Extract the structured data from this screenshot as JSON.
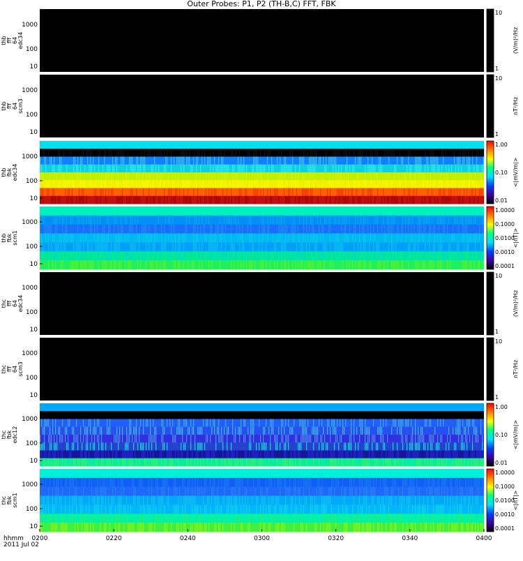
{
  "title": "Outer Probes: P1, P2 (TH-B,C) FFT, FBK",
  "x_axis": {
    "row_label": "hhmm",
    "date_label": "2011 Jul 02",
    "ticks": [
      "0200",
      "0220",
      "0240",
      "0300",
      "0320",
      "0340",
      "0400"
    ]
  },
  "chart_data": [
    {
      "type": "heatmap",
      "ylabel": [
        "thb",
        "fff",
        "64",
        "edc34"
      ],
      "colorbar_label": "(V/m)²/Hz",
      "colorbar_ticks": [
        "10",
        "1"
      ],
      "yticks": [
        "1000",
        "100",
        "10"
      ],
      "fill": "empty"
    },
    {
      "type": "heatmap",
      "ylabel": [
        "thb",
        "fff",
        "64",
        "scm3"
      ],
      "colorbar_label": "nT²/Hz",
      "colorbar_ticks": [
        "10",
        "1"
      ],
      "yticks": [
        "1000",
        "100",
        "10"
      ],
      "fill": "empty"
    },
    {
      "type": "heatmap",
      "ylabel": [
        "thb",
        "fbk",
        "edc34"
      ],
      "colorbar_label": "<|mV/m|>",
      "colorbar_ticks": [
        "1.00",
        "0.10",
        "0.01"
      ],
      "yticks": [
        "1000",
        "100",
        "10"
      ],
      "bands": [
        [
          "#00e0f0",
          "#00e0f0"
        ],
        [
          "#000000",
          "#101010"
        ],
        [
          "#1080ff",
          "#40c0ff"
        ],
        [
          "#10d0e0",
          "#30e8f0"
        ],
        [
          "#c0f000",
          "#d8f000"
        ],
        [
          "#f0f000",
          "#f8f800"
        ],
        [
          "#ff6000",
          "#ff3000"
        ],
        [
          "#c01010",
          "#a00000"
        ]
      ]
    },
    {
      "type": "heatmap",
      "ylabel": [
        "thb",
        "fbk",
        "scm1"
      ],
      "colorbar_label": "<|nT|>",
      "colorbar_ticks": [
        "1.0000",
        "0.1000",
        "0.0100",
        "0.0010",
        "0.0001"
      ],
      "yticks": [
        "1000",
        "100",
        "10"
      ],
      "bands": [
        [
          "#00f0c0",
          "#00f0c0"
        ],
        [
          "#0090f8",
          "#00a8f8"
        ],
        [
          "#1870f8",
          "#2088f8"
        ],
        [
          "#00b8f0",
          "#00c8f0"
        ],
        [
          "#00a0f8",
          "#00c0f8"
        ],
        [
          "#00e0b0",
          "#00f080"
        ],
        [
          "#20f060",
          "#60f020"
        ]
      ]
    },
    {
      "type": "heatmap",
      "ylabel": [
        "thc",
        "fff",
        "64",
        "edc34"
      ],
      "colorbar_label": "(V/m)²/Hz",
      "colorbar_ticks": [
        "10",
        "1"
      ],
      "yticks": [
        "1000",
        "100",
        "10"
      ],
      "fill": "empty"
    },
    {
      "type": "heatmap",
      "ylabel": [
        "thc",
        "fff",
        "64",
        "scm3"
      ],
      "colorbar_label": "nT²/Hz",
      "colorbar_ticks": [
        "10",
        "1"
      ],
      "yticks": [
        "1000",
        "100",
        "10"
      ],
      "fill": "empty"
    },
    {
      "type": "heatmap",
      "ylabel": [
        "thc",
        "fbk",
        "edc12"
      ],
      "colorbar_label": "<|mV/m|>",
      "colorbar_ticks": [
        "1.00",
        "0.10",
        "0.01"
      ],
      "yticks": [
        "1000",
        "100",
        "10"
      ],
      "bands": [
        [
          "#00a8f8",
          "#00a8f8"
        ],
        [
          "#000000",
          "#000000"
        ],
        [
          "#2060f8",
          "#40a8f8"
        ],
        [
          "#2850f0",
          "#40b8f8"
        ],
        [
          "#3030e0",
          "#4890f8"
        ],
        [
          "#2840d0",
          "#00e0e0"
        ],
        [
          "#2020c0",
          "#101080"
        ],
        [
          "#00f0a0",
          "#40f060"
        ]
      ]
    },
    {
      "type": "heatmap",
      "ylabel": [
        "thc",
        "fbk",
        "scm1"
      ],
      "colorbar_label": "<|nT|>",
      "colorbar_ticks": [
        "1.0000",
        "0.1000",
        "0.0100",
        "0.0010",
        "0.0001"
      ],
      "yticks": [
        "1000",
        "100",
        "10"
      ],
      "bands": [
        [
          "#00f0d8",
          "#00f0d8"
        ],
        [
          "#1060f8",
          "#1878f8"
        ],
        [
          "#2068f8",
          "#2880f8"
        ],
        [
          "#00a8f8",
          "#10c0f8"
        ],
        [
          "#00b8f8",
          "#00d8f0"
        ],
        [
          "#00f0b0",
          "#20f070"
        ],
        [
          "#40f040",
          "#90f010"
        ]
      ]
    }
  ],
  "colorbar_gradient": [
    "#ff0000",
    "#ff8000",
    "#ffff00",
    "#00ff80",
    "#00e0ff",
    "#0040ff",
    "#4000a0",
    "#000000"
  ]
}
